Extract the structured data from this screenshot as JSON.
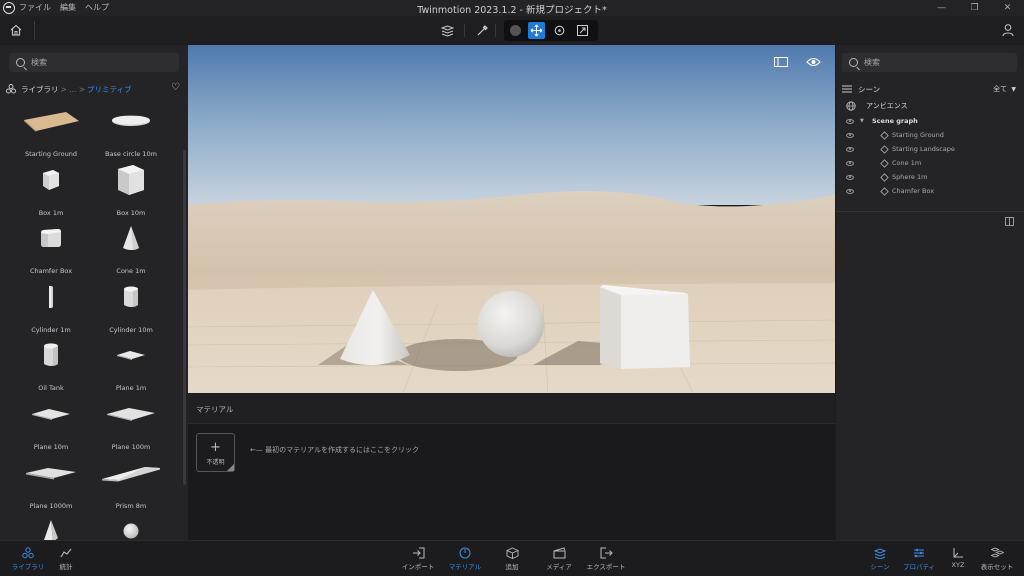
{
  "app": {
    "title": "Twinmotion 2023.1.2 - 新規プロジェクト*",
    "menu": [
      "ファイル",
      "編集",
      "ヘルプ"
    ],
    "window_controls": [
      "—",
      "❐",
      "✕"
    ]
  },
  "toolbar": {
    "tools": [
      "layers",
      "picker",
      "select",
      "move",
      "rotate",
      "scale"
    ]
  },
  "library": {
    "search_placeholder": "検索",
    "breadcrumb_root": "ライブラリ",
    "breadcrumb_sep": "> ... >",
    "breadcrumb_current": "プリミティブ",
    "items": [
      {
        "label": "Starting Ground",
        "icon": "ground"
      },
      {
        "label": "Base circle 10m",
        "icon": "disc"
      },
      {
        "label": "Box 1m",
        "icon": "box-small"
      },
      {
        "label": "Box 10m",
        "icon": "box-large"
      },
      {
        "label": "Chamfer Box",
        "icon": "chamfer-box"
      },
      {
        "label": "Cone 1m",
        "icon": "cone"
      },
      {
        "label": "Cylinder 1m",
        "icon": "cylinder-thin"
      },
      {
        "label": "Cylinder 10m",
        "icon": "cylinder"
      },
      {
        "label": "Oil Tank",
        "icon": "tank"
      },
      {
        "label": "Plane 1m",
        "icon": "plane-small"
      },
      {
        "label": "Plane 10m",
        "icon": "plane-medium"
      },
      {
        "label": "Plane 100m",
        "icon": "plane-large"
      },
      {
        "label": "Plane 1000m",
        "icon": "plane-huge"
      },
      {
        "label": "Prism 8m",
        "icon": "prism"
      },
      {
        "label": "",
        "icon": "pyramid"
      },
      {
        "label": "",
        "icon": "sphere"
      }
    ]
  },
  "materials": {
    "header": "マテリアル",
    "tile_label": "不透明",
    "hint": "←— 最初のマテリアルを作成するにはここをクリック"
  },
  "scene": {
    "search_placeholder": "検索",
    "title": "シーン",
    "filter": "全て",
    "ambience": "アンビエンス",
    "graph_root": "Scene graph",
    "objects": [
      "Starting Ground",
      "Starting Landscape",
      "Cone 1m",
      "Sphere 1m",
      "Chamfer Box"
    ]
  },
  "bottom": {
    "left": [
      {
        "label": "ライブラリ",
        "active": true
      },
      {
        "label": "統計",
        "active": false
      }
    ],
    "center": [
      {
        "label": "インポート",
        "active": false
      },
      {
        "label": "マテリアル",
        "active": true
      },
      {
        "label": "追加",
        "active": false
      },
      {
        "label": "メディア",
        "active": false
      },
      {
        "label": "エクスポート",
        "active": false
      }
    ],
    "right": [
      {
        "label": "シーン",
        "active": true
      },
      {
        "label": "プロパティ",
        "active": true
      },
      {
        "label": "XYZ",
        "active": false
      },
      {
        "label": "表示セット",
        "active": false
      }
    ]
  },
  "colors": {
    "accent": "#1f7bd6",
    "panel": "#242427",
    "background": "#1c1c1f"
  }
}
